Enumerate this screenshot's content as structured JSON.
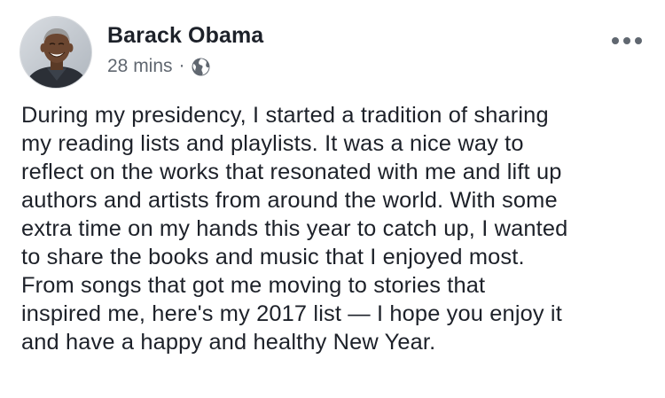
{
  "post": {
    "author": {
      "name": "Barack Obama",
      "avatar": "profile-photo"
    },
    "meta": {
      "timestamp": "28 mins",
      "separator": "·",
      "privacy_icon": "globe-icon"
    },
    "more_icon": "more-options-icon",
    "text_lines": [
      "During my presidency, I started a tradition of sharing",
      "my reading lists and playlists. It was a nice way to",
      "reflect on the works that resonated with me and lift up",
      "authors and artists from around the world. With some",
      "extra time on my hands this year to catch up, I wanted",
      "to share the books and music that I enjoyed most.",
      "From songs that got me moving to stories that",
      "inspired me, here's my 2017 list — I hope you enjoy it",
      "and have a happy and healthy New Year."
    ]
  },
  "colors": {
    "text_primary": "#1d2129",
    "text_secondary": "#606770",
    "background": "#ffffff"
  }
}
